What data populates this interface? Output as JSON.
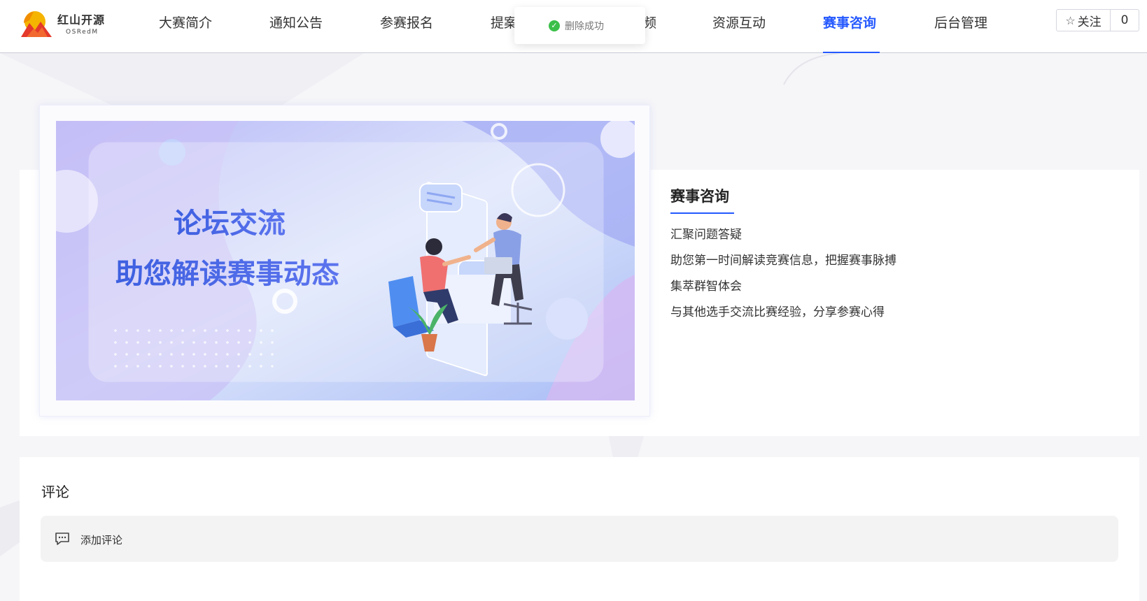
{
  "brand": {
    "name_cn": "红山开源",
    "name_en": "OSRedM"
  },
  "nav": {
    "items": [
      {
        "label": "大赛简介",
        "active": false
      },
      {
        "label": "通知公告",
        "active": false
      },
      {
        "label": "参赛报名",
        "active": false
      },
      {
        "label": "提案",
        "active": false
      },
      {
        "label": "频",
        "active": false
      },
      {
        "label": "资源互动",
        "active": false
      },
      {
        "label": "赛事咨询",
        "active": true
      },
      {
        "label": "后台管理",
        "active": false
      }
    ]
  },
  "follow": {
    "label": "关注",
    "count": "0",
    "icon": "star-icon"
  },
  "toast": {
    "message": "删除成功",
    "icon": "check-circle-icon",
    "color": "#3bbf4a"
  },
  "banner": {
    "line1": "论坛交流",
    "line2": "助您解读赛事动态"
  },
  "intro": {
    "title": "赛事咨询",
    "lines": [
      "汇聚问题答疑",
      "助您第一时间解读竞赛信息，把握赛事脉搏",
      "集萃群智体会",
      "与其他选手交流比赛经验，分享参赛心得"
    ]
  },
  "comments": {
    "title": "评论",
    "add_label": "添加评论",
    "icon": "comment-icon"
  },
  "colors": {
    "accent": "#2458ff",
    "success": "#3bbf4a"
  }
}
